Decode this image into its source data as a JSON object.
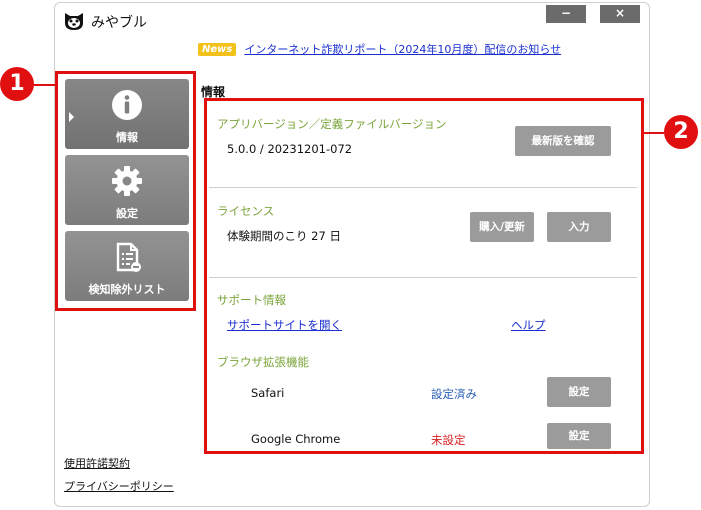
{
  "app": {
    "title": "みやブル"
  },
  "window_controls": {
    "minimize": "−",
    "close": "×"
  },
  "news": {
    "badge": "News",
    "text": "インターネット詐欺リポート（2024年10月度）配信のお知らせ"
  },
  "sidebar": {
    "items": [
      {
        "label": "情報",
        "icon": "info-icon",
        "active": true
      },
      {
        "label": "設定",
        "icon": "gear-icon",
        "active": false
      },
      {
        "label": "検知除外リスト",
        "icon": "exclusion-list-icon",
        "active": false
      }
    ]
  },
  "footer": {
    "license_agreement": "使用許諾契約",
    "privacy_policy": "プライバシーポリシー"
  },
  "main": {
    "section_title": "情報",
    "version": {
      "heading": "アプリバージョン／定義ファイルバージョン",
      "value": "5.0.0 / 20231201-072",
      "check_button": "最新版を確認"
    },
    "license": {
      "heading": "ライセンス",
      "status": "体験期間のこり 27 日",
      "purchase_button": "購入/更新",
      "input_button": "入力"
    },
    "support": {
      "heading": "サポート情報",
      "support_site_link": "サポートサイトを開く",
      "help_link": "ヘルプ"
    },
    "extensions": {
      "heading": "ブラウザ拡張機能",
      "rows": [
        {
          "browser": "Safari",
          "status": "設定済み",
          "status_type": "ok",
          "button": "設定"
        },
        {
          "browser": "Google Chrome",
          "status": "未設定",
          "status_type": "ng",
          "button": "設定"
        }
      ]
    }
  },
  "annotations": {
    "marker_1": "1",
    "marker_2": "2"
  },
  "colors": {
    "accent_green": "#7aa43a",
    "link_blue": "#1a2fd0",
    "status_ok": "#2a5db8",
    "status_ng": "#d72020",
    "annotation_red": "#e01010"
  }
}
